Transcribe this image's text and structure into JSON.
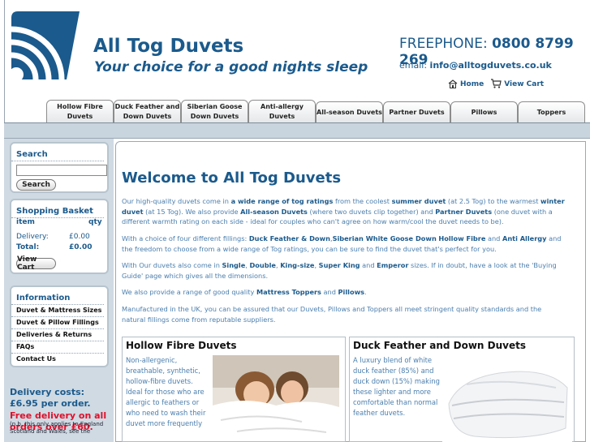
{
  "header": {
    "title": "All Tog Duvets",
    "tagline": "Your choice for a good nights sleep",
    "freephone_label": "FREEPHONE:",
    "freephone_number": "0800 8799 269",
    "email_label": "email:",
    "email_address": "info@alltogduvets.co.uk",
    "home_link": "Home",
    "cart_link": "View Cart"
  },
  "tabs": [
    {
      "line1": "Hollow Fibre",
      "line2": "Duvets"
    },
    {
      "line1": "Duck Feather and",
      "line2": "Down Duvets"
    },
    {
      "line1": "Siberian Goose",
      "line2": "Down Duvets"
    },
    {
      "line1": "Anti-allergy",
      "line2": "Duvets"
    },
    {
      "line1": "All-season Duvets",
      "line2": ""
    },
    {
      "line1": "Partner Duvets",
      "line2": ""
    },
    {
      "line1": "Pillows",
      "line2": ""
    },
    {
      "line1": "Toppers",
      "line2": ""
    }
  ],
  "sidebar": {
    "search_title": "Search",
    "search_button": "Search",
    "basket_title": "Shopping Basket",
    "basket_item_col": "item",
    "basket_qty_col": "qty",
    "delivery_label": "Delivery:",
    "delivery_value": "£0.00",
    "total_label": "Total:",
    "total_value": "£0.00",
    "view_cart_button": "View Cart",
    "info_title": "Information",
    "info_links": [
      "Duvet & Mattress Sizes",
      "Duvet & Pillow Fillings",
      "Deliveries & Returns",
      "FAQs",
      "Contact Us"
    ],
    "delivery_costs_text": "Delivery costs: £6.95 per order.",
    "free_delivery_text": "Free delivery on all orders over £60.",
    "delivery_note_line1": "(n.b. this only applies to England",
    "delivery_note_line2": "Scotland and Wales, see the"
  },
  "main": {
    "title": "Welcome to All Tog Duvets",
    "p1": {
      "a": "Our high-quality duvets come in ",
      "b": "a wide range of tog ratings",
      "c": " from the coolest ",
      "d": "summer duvet",
      "e": " (at 2.5 Tog) to the warmest ",
      "f": "winter duvet",
      "g": " (at 15 Tog). We also provide ",
      "h": "All-season Duvets",
      "i": " (where two duvets clip together) and ",
      "j": "Partner Duvets",
      "k": " (one duvet with a different warmth rating on each side - ideal for couples who can't agree on how warm/cool the duvet needs to be)."
    },
    "p2": {
      "a": "With a choice of four different fillings: ",
      "b": "Duck Feather & Down",
      "c": ",",
      "d": "Siberian White Goose Down",
      "e": " ",
      "f": "Hollow Fibre",
      "g": " and ",
      "h": "Anti Allergy",
      "i": " and the freedom to choose from a wide range of Tog ratings, you can be sure to find the duvet that's perfect for you."
    },
    "p3": {
      "a": "With Our duvets also come in ",
      "b": "Single",
      "c": ", ",
      "d": "Double",
      "e": ", ",
      "f": "King-size",
      "g": ", ",
      "h": "Super King",
      "i": " and ",
      "j": "Emperor",
      "k": " sizes.  If in doubt, have a look at the 'Buying Guide' page which gives all the dimensions."
    },
    "p4": {
      "a": "We also provide a range of good quality ",
      "b": "Mattress Toppers",
      "c": " and ",
      "d": "Pillows",
      "e": "."
    },
    "p5": "Manufactured in the UK, you can be assured that our Duvets, Pillows and Toppers all meet stringent quality standards and the natural fillings come from reputable suppliers."
  },
  "cards": [
    {
      "title": "Hollow Fibre Duvets",
      "text": "Non-allergenic, breathable, synthetic, hollow-fibre duvets. Ideal for those who are allergic to feathers or who need to wash their duvet more frequently"
    },
    {
      "title": "Duck Feather and Down Duvets",
      "text": "A luxury blend of white duck feather (85%) and duck down (15%) making these lighter and more comfortable than normal feather duvets."
    }
  ],
  "colors": {
    "brand": "#1b5a8c",
    "body_text": "#4b7fae",
    "sidebar_bg": "#cfdae3",
    "free_delivery": "#e0102a"
  }
}
